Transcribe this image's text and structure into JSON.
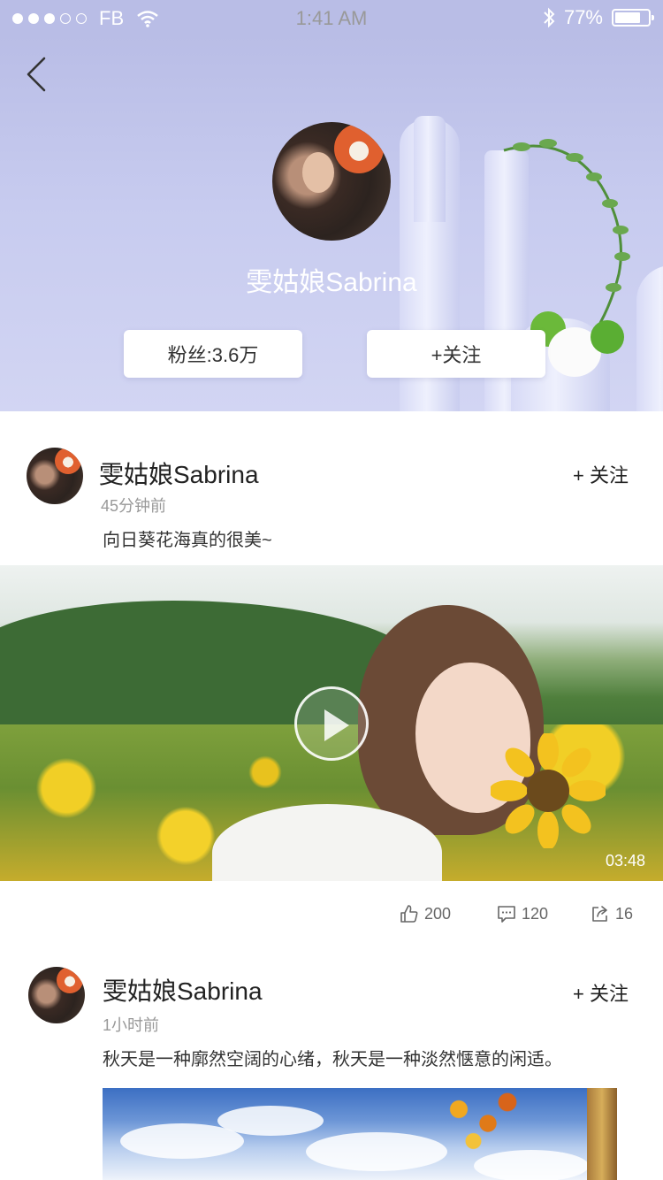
{
  "status_bar": {
    "carrier": "FB",
    "time": "1:41 AM",
    "battery": "77%",
    "battery_level": 0.77,
    "signal_filled": 3,
    "signal_total": 5
  },
  "profile": {
    "name": "雯姑娘Sabrina",
    "fans_label": "粉丝:3.6万",
    "follow_label": "+关注"
  },
  "posts": [
    {
      "author": "雯姑娘Sabrina",
      "time": "45分钟前",
      "follow": "+ 关注",
      "caption": "向日葵花海真的很美~",
      "duration": "03:48",
      "likes": "200",
      "comments": "120",
      "shares": "16"
    },
    {
      "author": "雯姑娘Sabrina",
      "time": "1小时前",
      "follow": "+ 关注",
      "caption": "秋天是一种廓然空阔的心绪，秋天是一种淡然惬意的闲适。"
    }
  ],
  "icons": {
    "back": "chevron-left-icon",
    "like": "thumbs-up-icon",
    "comment": "comment-icon",
    "share": "share-icon",
    "play": "play-icon",
    "wifi": "wifi-icon",
    "bluetooth": "bluetooth-icon"
  }
}
